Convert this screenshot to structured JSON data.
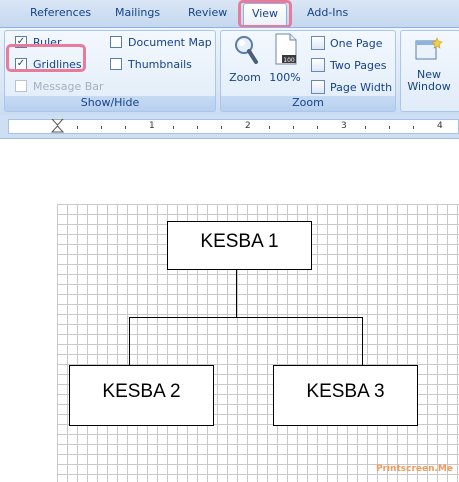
{
  "tabs": [
    {
      "label": "References"
    },
    {
      "label": "Mailings"
    },
    {
      "label": "Review"
    },
    {
      "label": "View"
    },
    {
      "label": "Add-Ins"
    }
  ],
  "show_hide": {
    "label": "Show/Hide",
    "ruler": {
      "label": "Ruler",
      "checked": true
    },
    "gridlines": {
      "label": "Gridlines",
      "checked": true
    },
    "message_bar": {
      "label": "Message Bar",
      "checked": false
    },
    "document_map": {
      "label": "Document Map",
      "checked": false
    },
    "thumbnails": {
      "label": "Thumbnails",
      "checked": false
    }
  },
  "zoom_group": {
    "label": "Zoom",
    "zoom_label": "Zoom",
    "hundred_label": "100%",
    "one_page": "One Page",
    "two_pages": "Two Pages",
    "page_width": "Page Width"
  },
  "window_group": {
    "new_window_line1": "New",
    "new_window_line2": "Window"
  },
  "ruler": {
    "numbers": [
      "1",
      "2",
      "3",
      "4"
    ]
  },
  "diagram": {
    "boxes": [
      {
        "label": "KESBA 1"
      },
      {
        "label": "KESBA 2"
      },
      {
        "label": "KESBA 3"
      }
    ]
  },
  "watermark": "Printscreen.Me",
  "colors": {
    "highlight": "#e87b9a",
    "ribbon_text": "#15428b"
  }
}
